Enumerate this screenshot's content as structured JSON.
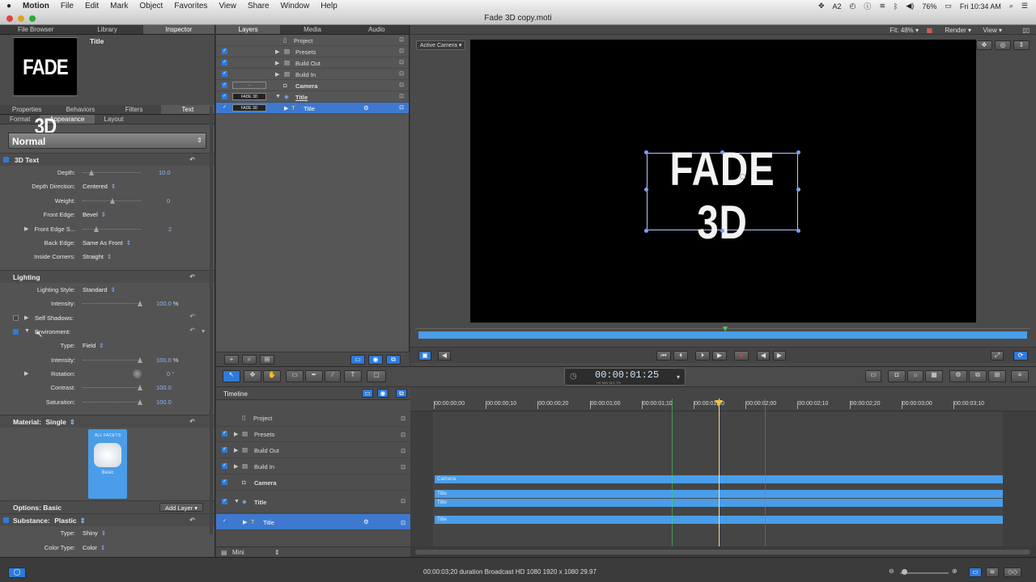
{
  "menubar": {
    "apple": "",
    "items": [
      "Motion",
      "File",
      "Edit",
      "Mark",
      "Object",
      "Favorites",
      "View",
      "Share",
      "Window",
      "Help"
    ],
    "battery": "76%",
    "clock": "Fri 10:34 AM",
    "a2": "2"
  },
  "window": {
    "title": "Fade 3D copy.moti"
  },
  "left": {
    "top_tabs": [
      "File Browser",
      "Library",
      "Inspector"
    ],
    "preview_title": "Title",
    "preview_text": "FADE 3D",
    "inspector_tabs": [
      "Properties",
      "Behaviors",
      "Filters",
      "Text"
    ],
    "sub_tabs": [
      "Format",
      "Appearance",
      "Layout"
    ],
    "preset": "Normal",
    "text3d": {
      "header": "3D Text",
      "depth_label": "Depth:",
      "depth_value": "10.0",
      "depth_level": 0.12,
      "depth_dir_label": "Depth Direction:",
      "depth_dir_value": "Centered",
      "weight_label": "Weight:",
      "weight_value": "0",
      "weight_level": 0.5,
      "front_edge_label": "Front Edge:",
      "front_edge_value": "Bevel",
      "front_edge_s_label": "Front Edge S...",
      "front_edge_s_value": "2",
      "front_edge_s_level": 0.2,
      "back_edge_label": "Back Edge:",
      "back_edge_value": "Same As Front",
      "inside_corners_label": "Inside Corners:",
      "inside_corners_value": "Straight"
    },
    "lighting": {
      "header": "Lighting",
      "style_label": "Lighting Style:",
      "style_value": "Standard",
      "intensity_label": "Intensity:",
      "intensity_value": "100.0",
      "intensity_unit": "%",
      "intensity_level": 1.0,
      "self_shadows": "Self Shadows:",
      "environment": "Environment:",
      "type_label": "Type:",
      "type_value": "Field",
      "env_intensity_label": "Intensity:",
      "env_intensity_value": "100.0",
      "env_intensity_unit": "%",
      "env_intensity_level": 1.0,
      "rotation_label": "Rotation:",
      "rotation_value": "0 °",
      "contrast_label": "Contrast:",
      "contrast_value": "100.0",
      "contrast_level": 1.0,
      "saturation_label": "Saturation:",
      "saturation_value": "100.0",
      "saturation_level": 1.0
    },
    "material": {
      "label": "Material:",
      "value": "Single",
      "tile_top": "ALL FACETS",
      "tile_name": "Basic",
      "options_label": "Options: Basic",
      "add_layer": "Add Layer",
      "substance_label": "Substance:",
      "substance_value": "Plastic",
      "type_label": "Type:",
      "type_value": "Shiny",
      "color_type_label": "Color Type:",
      "color_type_value": "Color"
    }
  },
  "layers": {
    "tabs": [
      "Layers",
      "Media",
      "Audio"
    ],
    "rows": [
      {
        "name": "Project"
      },
      {
        "name": "Presets"
      },
      {
        "name": "Build Out"
      },
      {
        "name": "Build In"
      },
      {
        "name": "Camera"
      },
      {
        "name": "Title",
        "thumb": "FADE 3D"
      },
      {
        "name": "Title",
        "thumb": "FADE 3D"
      }
    ]
  },
  "canvas": {
    "active_camera": "Active Camera",
    "fit": "Fit: 48%",
    "render": "Render",
    "view": "View",
    "title_text": "FADE 3D"
  },
  "transport": {
    "timecode": "00:00:01:25",
    "tc_units": "HR   MIN   SEC   FR"
  },
  "timeline": {
    "header": "Timeline",
    "ruler": [
      "00:00:00;00",
      "00:00:00;10",
      "00:00:00;20",
      "00:00:01;00",
      "00:00:01;10",
      "00:00:01;20",
      "00:00:02;00",
      "00:00:02;10",
      "00:00:02;20",
      "00:00:03;00",
      "00:00:03;10"
    ],
    "rows": [
      "Project",
      "Presets",
      "Build Out",
      "Build In",
      "Camera",
      "Title",
      "Title"
    ],
    "bars": [
      "Camera",
      "Title",
      "Title",
      "Title"
    ],
    "mini": "Mini"
  },
  "status": {
    "info": "00:00:03;20 duration Broadcast HD 1080 1920 x 1080 29.97"
  },
  "colors": {
    "accent": "#2f7ad9",
    "bar": "#4a9de8",
    "selection": "#3f78cf"
  }
}
